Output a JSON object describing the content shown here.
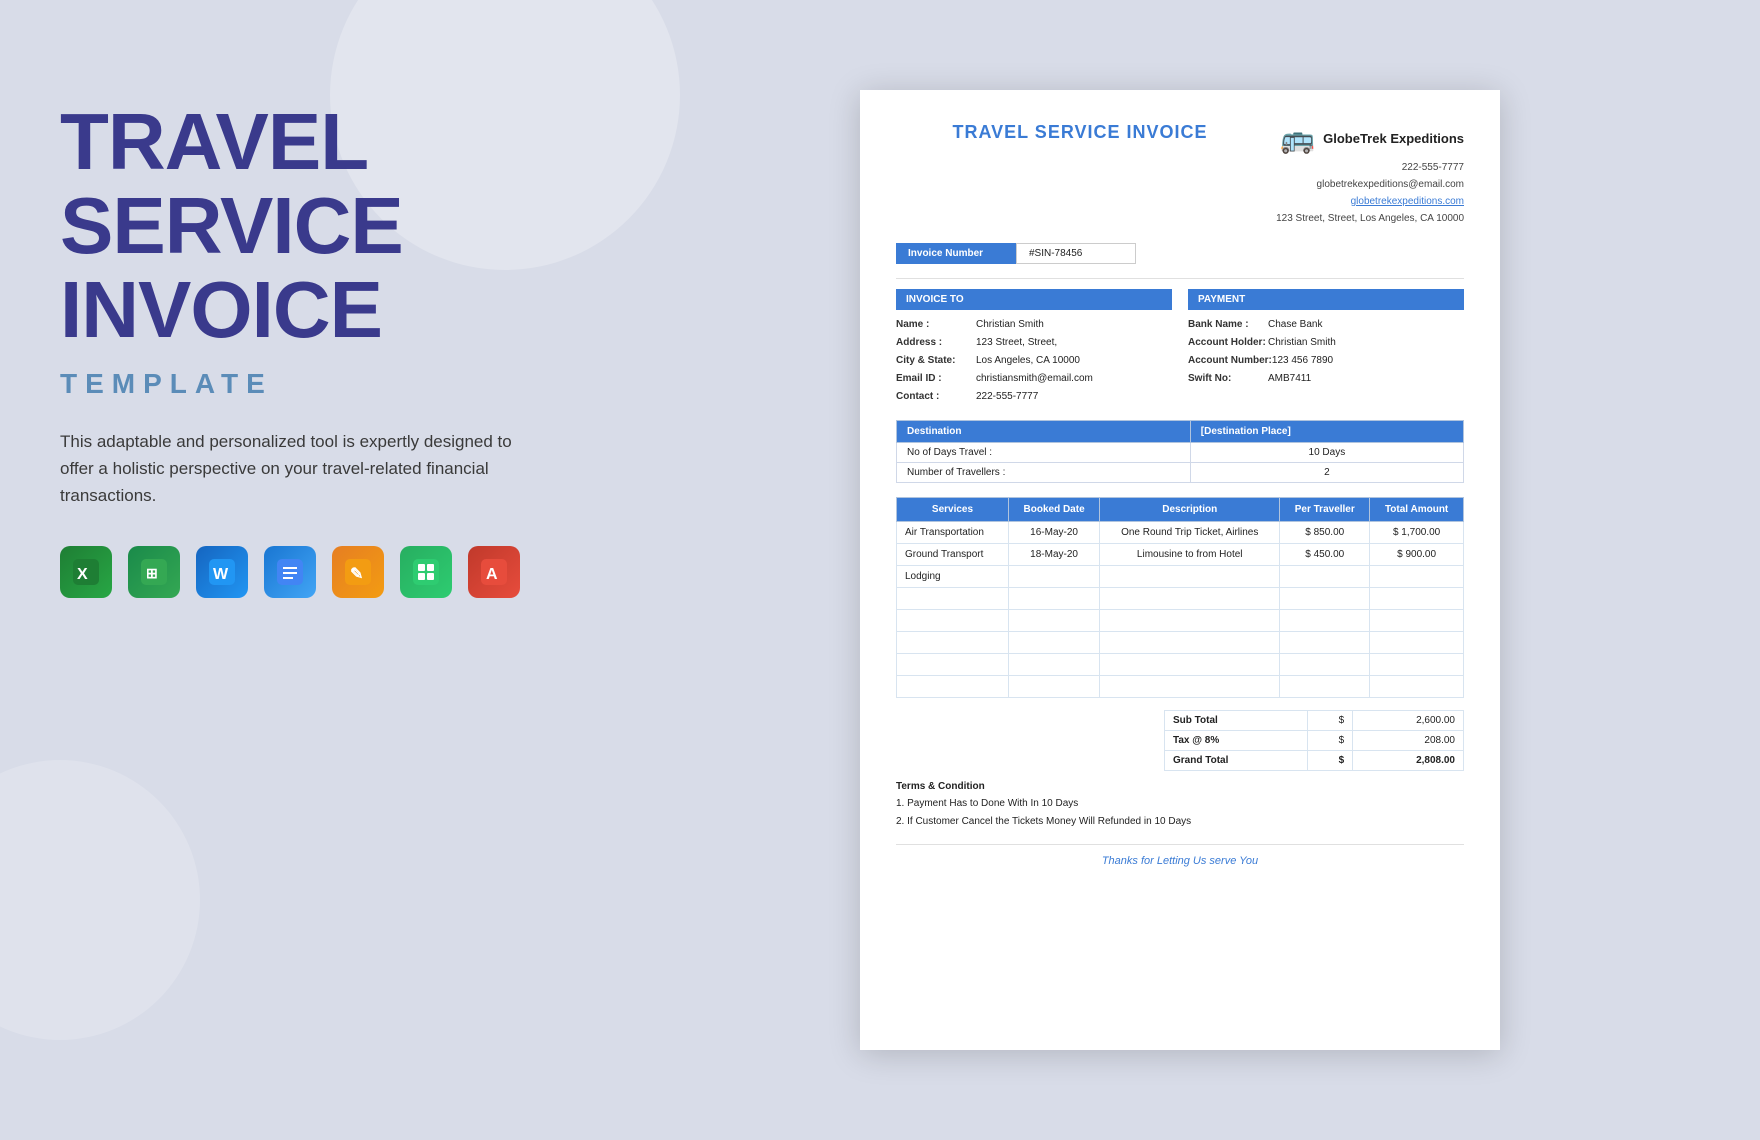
{
  "left": {
    "title_line1": "TRAVEL",
    "title_line2": "SERVICE",
    "title_line3": "INVOICE",
    "subtitle": "TEMPLATE",
    "description": "This adaptable and personalized tool is expertly designed to offer a holistic perspective on your travel-related financial transactions.",
    "icons": [
      {
        "name": "excel-icon",
        "label": "X",
        "class": "icon-excel"
      },
      {
        "name": "gsheets-icon",
        "label": "▦",
        "class": "icon-gsheets"
      },
      {
        "name": "word-icon",
        "label": "W",
        "class": "icon-word"
      },
      {
        "name": "gdocs-icon",
        "label": "≡",
        "class": "icon-gdocs"
      },
      {
        "name": "pages-icon",
        "label": "✎",
        "class": "icon-pages"
      },
      {
        "name": "numbers-icon",
        "label": "▦",
        "class": "icon-numbers"
      },
      {
        "name": "acrobat-icon",
        "label": "A",
        "class": "icon-acrobat"
      }
    ]
  },
  "invoice": {
    "title": "TRAVEL SERVICE INVOICE",
    "company": {
      "name": "GlobeTrek Expeditions",
      "phone": "222-555-7777",
      "email": "globetrekexpeditions@email.com",
      "website": "globetrekexpeditions.com",
      "address": "123 Street, Street, Los Angeles, CA 10000"
    },
    "invoice_number_label": "Invoice Number",
    "invoice_number_value": "#SIN-78456",
    "invoice_to": {
      "header": "INVOICE TO",
      "name_label": "Name :",
      "name_value": "Christian Smith",
      "address_label": "Address :",
      "address_value": "123 Street, Street,",
      "city_label": "City & State:",
      "city_value": "Los Angeles, CA 10000",
      "email_label": "Email ID :",
      "email_value": "christiansmith@email.com",
      "contact_label": "Contact :",
      "contact_value": "222-555-7777"
    },
    "payment": {
      "header": "PAYMENT",
      "bank_label": "Bank Name :",
      "bank_value": "Chase Bank",
      "holder_label": "Account Holder:",
      "holder_value": "Christian Smith",
      "account_label": "Account Number:",
      "account_value": "123 456 7890",
      "swift_label": "Swift No:",
      "swift_value": "AMB7411"
    },
    "destination": {
      "col1": "Destination",
      "col2": "[Destination Place]",
      "days_label": "No of Days Travel :",
      "days_value": "10 Days",
      "travellers_label": "Number of Travellers :",
      "travellers_value": "2"
    },
    "services_headers": [
      "Services",
      "Booked Date",
      "Description",
      "Per Traveller",
      "Total Amount"
    ],
    "services": [
      {
        "service": "Air Transportation",
        "date": "16-May-20",
        "description": "One Round Trip Ticket, Airlines",
        "per_traveller_symbol": "$",
        "per_traveller": "850.00",
        "total_symbol": "$",
        "total": "1,700.00"
      },
      {
        "service": "Ground Transport",
        "date": "18-May-20",
        "description": "Limousine to from Hotel",
        "per_traveller_symbol": "$",
        "per_traveller": "450.00",
        "total_symbol": "$",
        "total": "900.00"
      },
      {
        "service": "Lodging",
        "date": "",
        "description": "",
        "per_traveller_symbol": "",
        "per_traveller": "",
        "total_symbol": "",
        "total": ""
      }
    ],
    "empty_rows": 5,
    "totals": {
      "subtotal_label": "Sub Total",
      "subtotal_symbol": "$",
      "subtotal_value": "2,600.00",
      "tax_label": "Tax @ 8%",
      "tax_symbol": "$",
      "tax_value": "208.00",
      "grand_label": "Grand Total",
      "grand_symbol": "$",
      "grand_value": "2,808.00"
    },
    "terms": {
      "title": "Terms & Condition",
      "items": [
        "1. Payment Has to Done With In 10 Days",
        "2. If Customer Cancel the Tickets Money Will Refunded in 10 Days"
      ]
    },
    "footer": "Thanks for Letting Us serve You"
  }
}
